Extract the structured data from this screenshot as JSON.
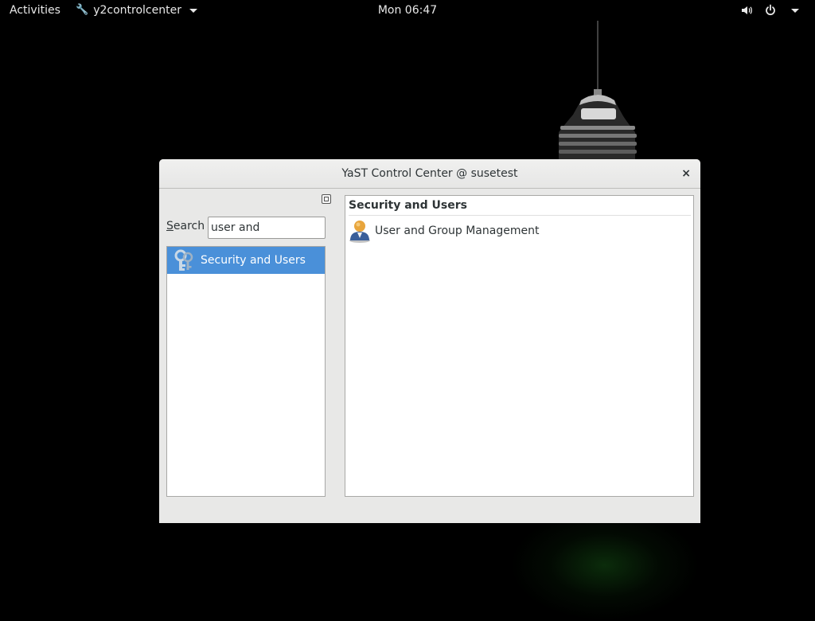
{
  "topbar": {
    "activities": "Activities",
    "app_name": "y2controlcenter",
    "clock": "Mon 06:47"
  },
  "window": {
    "title": "YaST Control Center @ susetest",
    "close_symbol": "×",
    "search": {
      "label_underlined": "S",
      "label_rest": "earch",
      "value": "user and"
    },
    "categories": [
      {
        "label": "Security and Users",
        "icon": "keys-icon",
        "selected": true
      }
    ],
    "modules_header": "Security and Users",
    "modules": [
      {
        "label": "User and Group Management",
        "icon": "user-icon"
      }
    ]
  },
  "colors": {
    "selection": "#4a90d9",
    "window_bg": "#e8e8e7",
    "desktop_bg": "#000000"
  }
}
